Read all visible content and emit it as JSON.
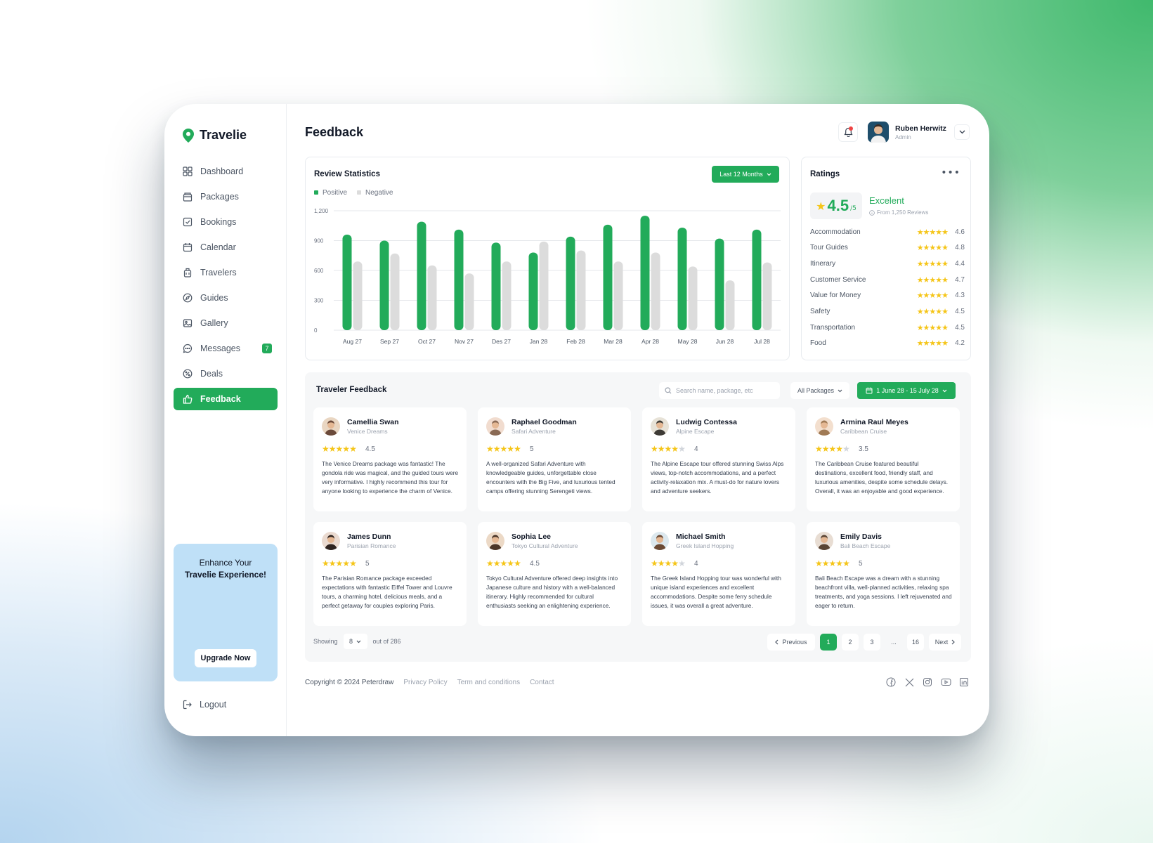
{
  "app": {
    "name": "Travelie"
  },
  "nav": {
    "items": [
      {
        "label": "Dashboard",
        "icon": "grid-icon"
      },
      {
        "label": "Packages",
        "icon": "package-icon"
      },
      {
        "label": "Bookings",
        "icon": "checkbox-icon"
      },
      {
        "label": "Calendar",
        "icon": "calendar-icon"
      },
      {
        "label": "Travelers",
        "icon": "luggage-icon"
      },
      {
        "label": "Guides",
        "icon": "compass-icon"
      },
      {
        "label": "Gallery",
        "icon": "image-icon"
      },
      {
        "label": "Messages",
        "icon": "chat-icon",
        "badge": "7"
      },
      {
        "label": "Deals",
        "icon": "discount-icon"
      },
      {
        "label": "Feedback",
        "icon": "thumbs-up-icon",
        "active": true
      }
    ]
  },
  "promo": {
    "line1": "Enhance Your",
    "line2": "Travelie Experience!",
    "button": "Upgrade Now"
  },
  "logout": "Logout",
  "header": {
    "title": "Feedback",
    "user_name": "Ruben Herwitz",
    "user_role": "Admin"
  },
  "stats": {
    "title": "Review Statistics",
    "period_button": "Last 12 Months"
  },
  "chart_data": {
    "type": "bar",
    "title": "Review Statistics",
    "categories": [
      "Aug 27",
      "Sep 27",
      "Oct 27",
      "Nov 27",
      "Des 27",
      "Jan 28",
      "Feb 28",
      "Mar 28",
      "Apr 28",
      "May 28",
      "Jun 28",
      "Jul 28"
    ],
    "series": [
      {
        "name": "Positive",
        "color": "#22ab5a",
        "values": [
          960,
          900,
          1090,
          1010,
          880,
          780,
          940,
          1060,
          1150,
          1030,
          920,
          1010
        ]
      },
      {
        "name": "Negative",
        "color": "#dcdcdc",
        "values": [
          690,
          770,
          650,
          570,
          690,
          890,
          800,
          690,
          780,
          640,
          500,
          680
        ]
      }
    ],
    "yticks": [
      "0",
      "300",
      "600",
      "900",
      "1,200"
    ],
    "ylim": [
      0,
      1200
    ],
    "grid": true,
    "legend": "top-left"
  },
  "ratings": {
    "title": "Ratings",
    "score": "4.5",
    "out_of": "/5",
    "label": "Excelent",
    "sub": "From 1,250 Reviews",
    "items": [
      {
        "name": "Accommodation",
        "value": "4.6",
        "stars": "★★★★★"
      },
      {
        "name": "Tour Guides",
        "value": "4.8",
        "stars": "★★★★★"
      },
      {
        "name": "Itinerary",
        "value": "4.4",
        "stars": "★★★★★"
      },
      {
        "name": "Customer Service",
        "value": "4.7",
        "stars": "★★★★★"
      },
      {
        "name": "Value for Money",
        "value": "4.3",
        "stars": "★★★★★"
      },
      {
        "name": "Safety",
        "value": "4.5",
        "stars": "★★★★★"
      },
      {
        "name": "Transportation",
        "value": "4.5",
        "stars": "★★★★★"
      },
      {
        "name": "Food",
        "value": "4.2",
        "stars": "★★★★★"
      }
    ]
  },
  "feedback": {
    "title": "Traveler Feedback",
    "search_placeholder": "Search name, package, etc",
    "package_filter": "All Packages",
    "date_range": "1 June 28 - 15 July 28",
    "reviews": [
      {
        "name": "Camellia Swan",
        "package": "Venice Dreams",
        "stars": "★★★★★",
        "rating": "4.5",
        "text": "The Venice Dreams package was fantastic! The gondola ride was magical, and the guided tours were very informative. I highly recommend this tour for anyone looking to experience the charm of Venice."
      },
      {
        "name": "Raphael Goodman",
        "package": "Safari Adventure",
        "stars": "★★★★★",
        "rating": "5",
        "text": "A well-organized Safari Adventure with knowledgeable guides, unforgettable close encounters with the Big Five, and luxurious tented camps offering stunning Serengeti views."
      },
      {
        "name": "Ludwig Contessa",
        "package": "Alpine Escape",
        "stars": "★★★★★",
        "rating": "4",
        "text": "The Alpine Escape tour offered stunning Swiss Alps views, top-notch accommodations, and a perfect activity-relaxation mix. A must-do for nature lovers and adventure seekers."
      },
      {
        "name": "Armina Raul Meyes",
        "package": "Caribbean Cruise",
        "stars": "★★★★★",
        "rating": "3.5",
        "text": "The Caribbean Cruise featured beautiful destinations, excellent food, friendly staff, and luxurious amenities, despite some schedule delays. Overall, it was an enjoyable and good experience."
      },
      {
        "name": "James Dunn",
        "package": "Parisian Romance",
        "stars": "★★★★★",
        "rating": "5",
        "text": "The Parisian Romance package exceeded expectations with fantastic Eiffel Tower and Louvre tours, a charming hotel, delicious meals, and a perfect getaway for couples exploring Paris."
      },
      {
        "name": "Sophia Lee",
        "package": "Tokyo Cultural Adventure",
        "stars": "★★★★★",
        "rating": "4.5",
        "text": "Tokyo Cultural Adventure offered deep insights into Japanese culture and history with a well-balanced itinerary. Highly recommended for cultural enthusiasts seeking an enlightening experience."
      },
      {
        "name": "Michael Smith",
        "package": "Greek Island Hopping",
        "stars": "★★★★★",
        "rating": "4",
        "text": "The Greek Island Hopping tour was wonderful with unique island experiences and excellent accommodations. Despite some ferry schedule issues, it was overall a great adventure."
      },
      {
        "name": "Emily Davis",
        "package": "Bali Beach Escape",
        "stars": "★★★★★",
        "rating": "5",
        "text": "Bali Beach Escape was a dream with a stunning beachfront villa, well-planned activities, relaxing spa treatments, and yoga sessions. I left rejuvenated and eager to return."
      }
    ],
    "showing_label": "Showing",
    "per_page": "8",
    "total": "out of 286",
    "pager": {
      "prev": "Previous",
      "pages": [
        "1",
        "2",
        "3",
        "...",
        "16"
      ],
      "next": "Next"
    }
  },
  "footer": {
    "copyright": "Copyright © 2024 Peterdraw",
    "links": [
      "Privacy Policy",
      "Term and conditions",
      "Contact"
    ]
  },
  "colors": {
    "accent": "#22ab5a",
    "negative": "#dcdcdc",
    "star": "#f5c518",
    "promo": "#bfe0f7"
  }
}
